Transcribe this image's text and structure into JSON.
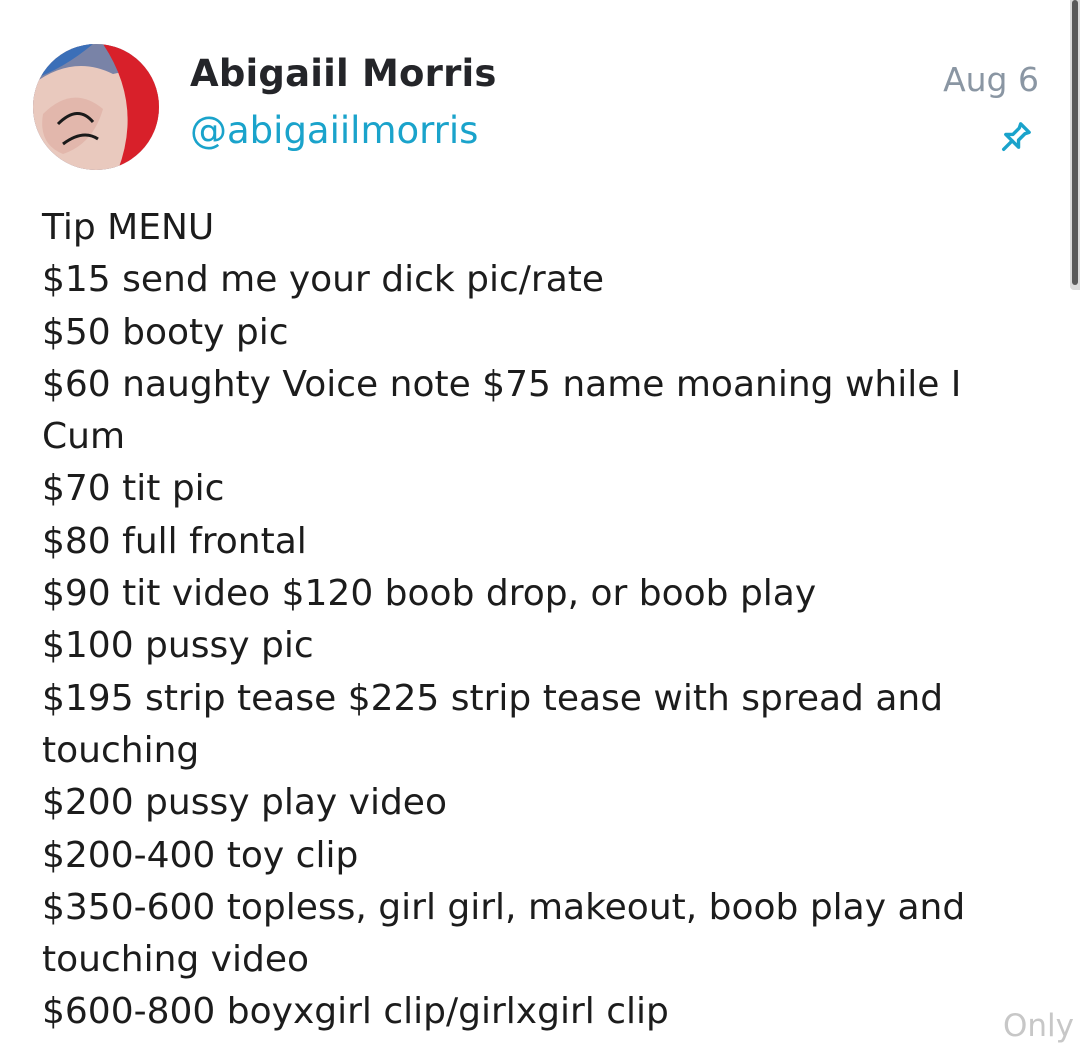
{
  "post": {
    "author": {
      "display_name": "Abigaiil Morris",
      "handle": "@abigaiilmorris"
    },
    "date": "Aug 6",
    "pin_icon": "pin-icon",
    "lines": [
      "Tip MENU",
      "$15 send me your dick pic/rate",
      "$50 booty pic",
      "$60 naughty Voice note $75 name moaning while I",
      "Cum",
      "$70 tit pic",
      "$80 full frontal",
      "$90 tit video $120 boob drop, or boob play",
      "$100 pussy pic",
      "$195 strip tease $225 strip tease with spread and",
      "touching",
      "$200 pussy play video",
      "$200-400 toy clip",
      "$350-600 topless, girl girl, makeout, boob play and",
      "touching video",
      "$600-800 boyxgirl clip/girlxgirl clip"
    ]
  },
  "watermark": "Only",
  "colors": {
    "handle": "#1aa3cb",
    "date": "#8a96a3",
    "pin": "#1aa3cb",
    "text": "#1c1c1c"
  }
}
